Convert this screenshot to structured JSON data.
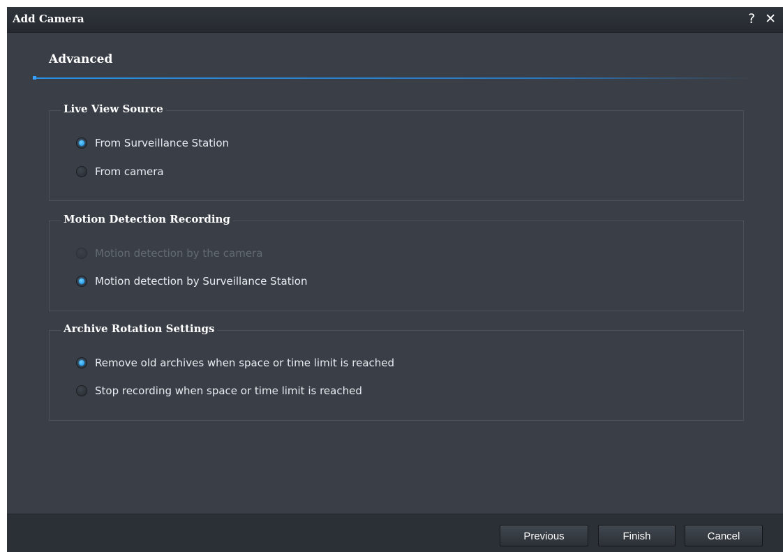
{
  "window": {
    "title": "Add Camera",
    "help_glyph": "?",
    "close_glyph": "✕"
  },
  "step": {
    "title": "Advanced"
  },
  "groups": {
    "live_view": {
      "legend": "Live View Source",
      "options": [
        {
          "label": "From Surveillance Station",
          "checked": true,
          "disabled": false
        },
        {
          "label": "From camera",
          "checked": false,
          "disabled": false
        }
      ]
    },
    "motion": {
      "legend": "Motion Detection Recording",
      "options": [
        {
          "label": "Motion detection by the camera",
          "checked": false,
          "disabled": true
        },
        {
          "label": "Motion detection by Surveillance Station",
          "checked": true,
          "disabled": false
        }
      ]
    },
    "archive": {
      "legend": "Archive Rotation Settings",
      "options": [
        {
          "label": "Remove old archives when space or time limit is reached",
          "checked": true,
          "disabled": false
        },
        {
          "label": "Stop recording when space or time limit is reached",
          "checked": false,
          "disabled": false
        }
      ]
    }
  },
  "footer": {
    "previous_label": "Previous",
    "finish_label": "Finish",
    "cancel_label": "Cancel"
  },
  "colors": {
    "accent": "#1a9bf0",
    "window_bg": "#3a3f47",
    "titlebar_bg": "#2b2f35"
  }
}
